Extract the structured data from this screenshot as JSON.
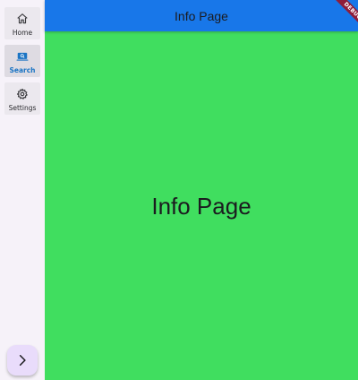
{
  "app_bar": {
    "title": "Info Page"
  },
  "navigation_rail": {
    "items": [
      {
        "label": "Home",
        "icon": "home-icon",
        "selected": false
      },
      {
        "label": "Search",
        "icon": "search-icon",
        "selected": true
      },
      {
        "label": "Settings",
        "icon": "gear-icon",
        "selected": false
      }
    ],
    "selected_color": "#1b74c4"
  },
  "fab": {
    "icon": "chevron-right-icon"
  },
  "content": {
    "title": "Info Page",
    "background": "#40de5f"
  },
  "debug_banner": {
    "label": "DEBUG"
  },
  "colors": {
    "app_bar": "#1877e9",
    "rail": "#f6f2f9",
    "fab": "#e9dcfb"
  }
}
